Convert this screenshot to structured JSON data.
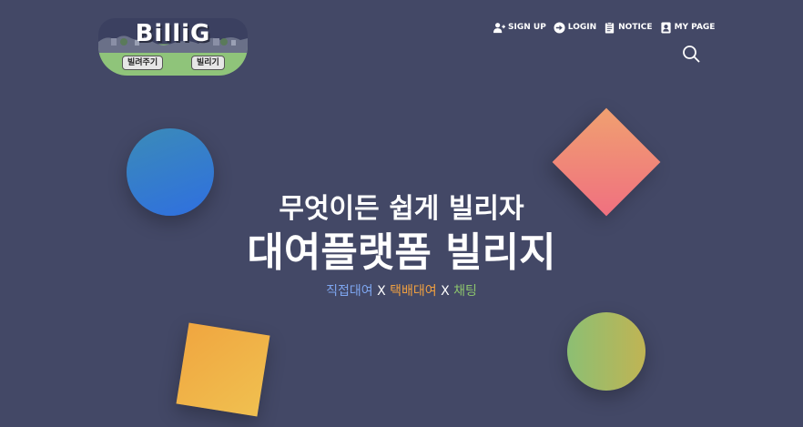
{
  "logo": {
    "text": "BilliG",
    "lend_label": "빌려주기",
    "borrow_label": "빌리기"
  },
  "nav": {
    "items": [
      {
        "label": "SIGN UP",
        "icon": "user-plus-icon"
      },
      {
        "label": "LOGIN",
        "icon": "login-arrow-icon"
      },
      {
        "label": "NOTICE",
        "icon": "clipboard-icon"
      },
      {
        "label": "MY PAGE",
        "icon": "user-card-icon"
      }
    ],
    "search_icon": "search-icon"
  },
  "hero": {
    "subtitle": "무엇이든 쉽게 빌리자",
    "title": "대여플랫폼 빌리지",
    "tag_direct": "직접대여",
    "tag_delivery": "택배대여",
    "tag_chat": "채팅",
    "separator": "X"
  },
  "colors": {
    "background": "#434866",
    "tag_direct": "#7ea6f0",
    "tag_delivery": "#f0a040",
    "tag_chat": "#8cc46c"
  }
}
